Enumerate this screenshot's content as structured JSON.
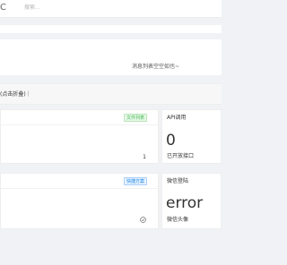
{
  "topbar": {
    "refresh_glyph": "C",
    "search_placeholder": "搜索..."
  },
  "notice": {
    "empty_text": "消息列表空空如也~"
  },
  "section": {
    "title": "(点击折叠)｜"
  },
  "cards": {
    "files": {
      "badge": "文件列表",
      "value": "1"
    },
    "api": {
      "title": "API调用",
      "value": "0",
      "subtitle": "已开放接口"
    },
    "quick": {
      "badge": "快捷方案"
    },
    "wechat": {
      "title": "微信登陆",
      "value": "error",
      "subtitle": "微信头像"
    }
  },
  "colors": {
    "badge_green": "#3fb950",
    "badge_blue": "#1e88e5",
    "background": "#f0f2f5"
  },
  "icons": {
    "refresh": "refresh-icon",
    "check": "check-circle-icon"
  }
}
